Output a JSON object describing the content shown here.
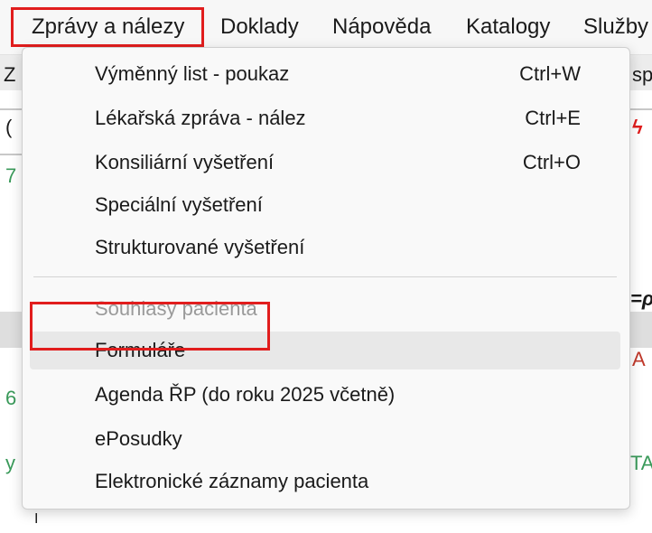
{
  "menubar": {
    "items": [
      {
        "label": "Zprávy a nálezy"
      },
      {
        "label": "Doklady"
      },
      {
        "label": "Nápověda"
      },
      {
        "label": "Katalogy"
      },
      {
        "label": "Služby"
      }
    ]
  },
  "background": {
    "left_fragments": [
      "Z",
      "(",
      "7",
      "6",
      "y",
      "I"
    ],
    "right_fragments": [
      "sp",
      "=ρ",
      "A",
      "TA"
    ],
    "right_icon": "lightning-icon"
  },
  "dropdown": {
    "items": [
      {
        "label": "Výměnný list - poukaz",
        "shortcut": "Ctrl+W",
        "disabled": false
      },
      {
        "label": "Lékařská zpráva - nález",
        "shortcut": "Ctrl+E",
        "disabled": false
      },
      {
        "label": "Konsiliární vyšetření",
        "shortcut": "Ctrl+O",
        "disabled": false
      },
      {
        "label": "Speciální vyšetření",
        "shortcut": "",
        "disabled": false
      },
      {
        "label": "Strukturované vyšetření",
        "shortcut": "",
        "disabled": false
      },
      {
        "label": "Souhlasy pacienta",
        "shortcut": "",
        "disabled": true
      },
      {
        "label": "Formuláře",
        "shortcut": "",
        "disabled": false,
        "highlighted": true
      },
      {
        "label": "Agenda ŘP (do roku 2025 včetně)",
        "shortcut": "",
        "disabled": false
      },
      {
        "label": "ePosudky",
        "shortcut": "",
        "disabled": false
      },
      {
        "label": "Elektronické záznamy pacienta",
        "shortcut": "",
        "disabled": false
      }
    ]
  },
  "colors": {
    "highlight_outline": "#e11d1d",
    "disabled_text": "#9a9a9a",
    "hover_background": "#e8e8e8"
  }
}
